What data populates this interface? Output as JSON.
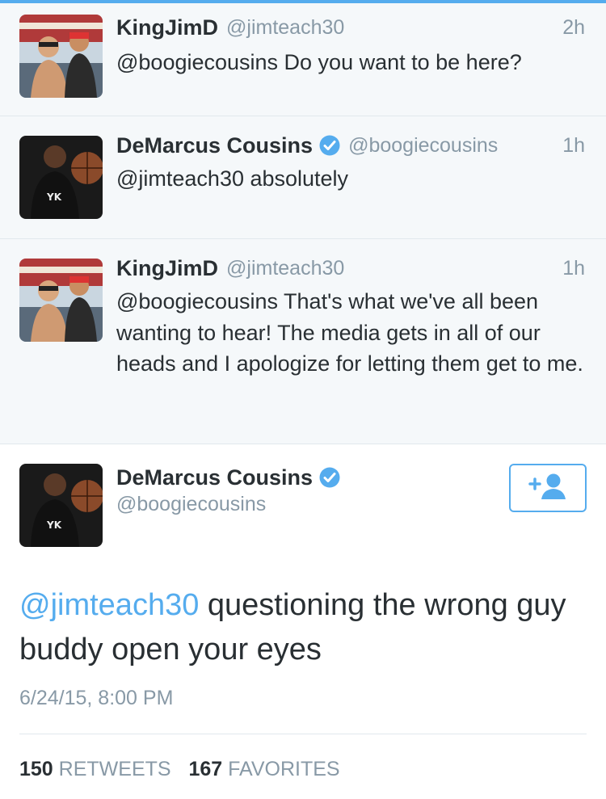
{
  "colors": {
    "accent": "#55acee",
    "verified": "#55acee",
    "muted": "#8899a6",
    "text": "#292f33",
    "reply_bg": "#f5f8fa"
  },
  "replies": [
    {
      "name": "KingJimD",
      "handle": "@jimteach30",
      "time": "2h",
      "text": "@boogiecousins Do you want to be here?",
      "avatar": "avatar-kingjimd"
    },
    {
      "name": "DeMarcus Cousins",
      "handle": "@boogiecousins",
      "time": "1h",
      "text": "@jimteach30 absolutely",
      "avatar": "avatar-demarcus",
      "verified_icon": "verified-badge-icon"
    },
    {
      "name": "KingJimD",
      "handle": "@jimteach30",
      "time": "1h",
      "text": "@boogiecousins That's what we've all been wanting to hear! The media gets in all of our heads and I apologize for letting them get to me.",
      "avatar": "avatar-kingjimd"
    }
  ],
  "main_tweet": {
    "name": "DeMarcus Cousins",
    "handle": "@boogiecousins",
    "verified_icon": "verified-badge-icon",
    "follow_icon": "follow-add-user-icon",
    "mention": "@jimteach30",
    "text": " questioning the wrong guy buddy open your eyes",
    "timestamp": "6/24/15, 8:00 PM",
    "retweets_count": "150",
    "retweets_label": "RETWEETS",
    "favorites_count": "167",
    "favorites_label": "FAVORITES"
  }
}
